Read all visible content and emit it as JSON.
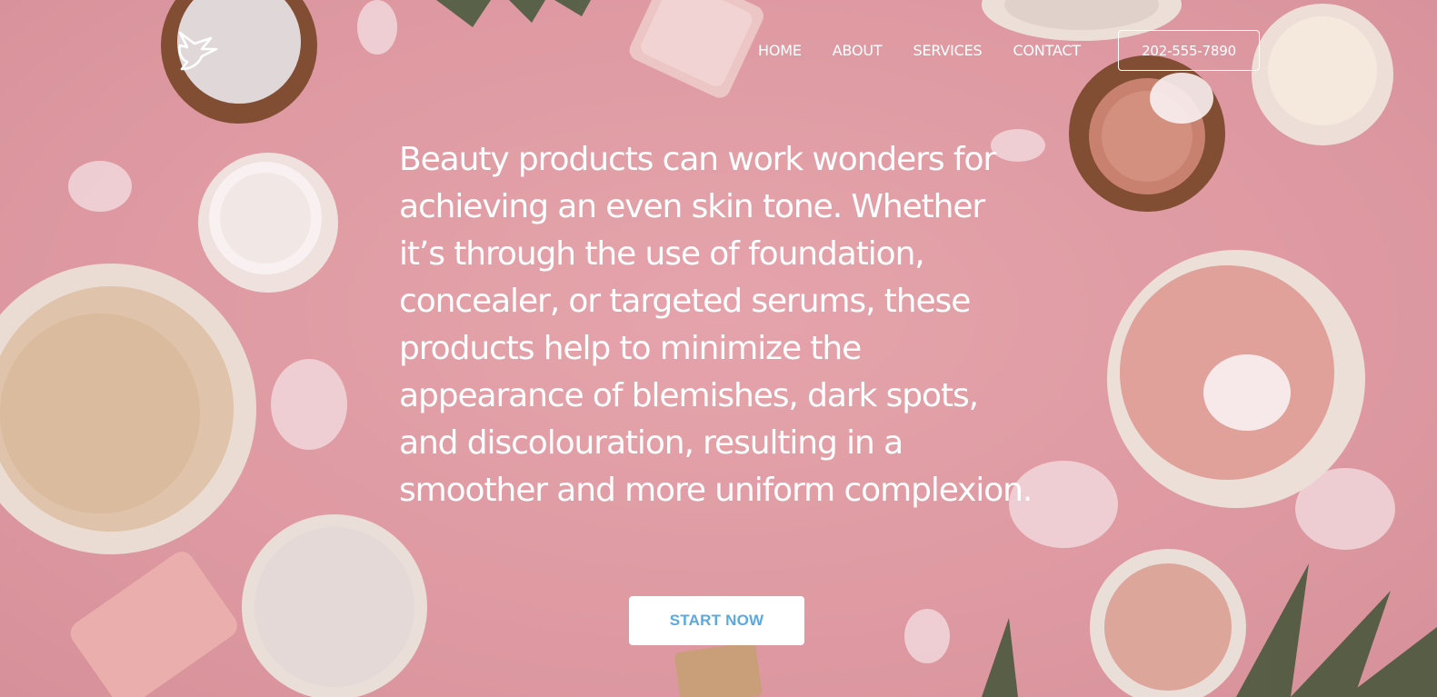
{
  "header": {
    "logo_icon": "bird-logo-icon",
    "nav": [
      {
        "label": "HOME"
      },
      {
        "label": "ABOUT"
      },
      {
        "label": "SERVICES"
      },
      {
        "label": "CONTACT"
      }
    ],
    "phone_label": "202-555-7890"
  },
  "hero": {
    "background": "pink flat-lay of skincare products",
    "headline": "Beauty products can work wonders for achieving an even skin tone. Whether it’s through the use of foundation, concealer, or targeted serums, these products help to minimize the appearance of blemishes, dark spots, and discolouration, resulting in a smoother and more uniform complexion.",
    "cta_label": "START NOW"
  },
  "colors": {
    "background_pink": "#e8a5ad",
    "text": "#ffffff",
    "cta_text": "#5aa9e0"
  }
}
